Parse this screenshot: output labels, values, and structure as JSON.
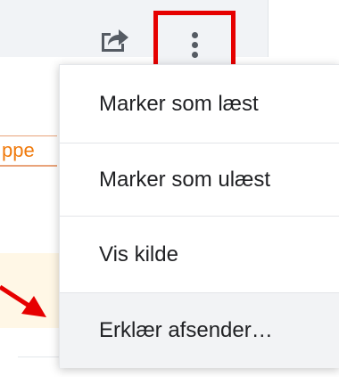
{
  "toolbar": {
    "share_icon": "share-icon",
    "more_icon": "more-vertical-icon",
    "highlight_color": "#e60000"
  },
  "background": {
    "snippet_text": "ppe",
    "snippet_color": "#f07a0c"
  },
  "menu": {
    "items": [
      {
        "label": "Marker som læst"
      },
      {
        "label": "Marker som ulæst"
      },
      {
        "label": "Vis kilde"
      },
      {
        "label": "Erklær afsender…"
      }
    ]
  },
  "annotation": {
    "arrow_color": "#e60000"
  }
}
